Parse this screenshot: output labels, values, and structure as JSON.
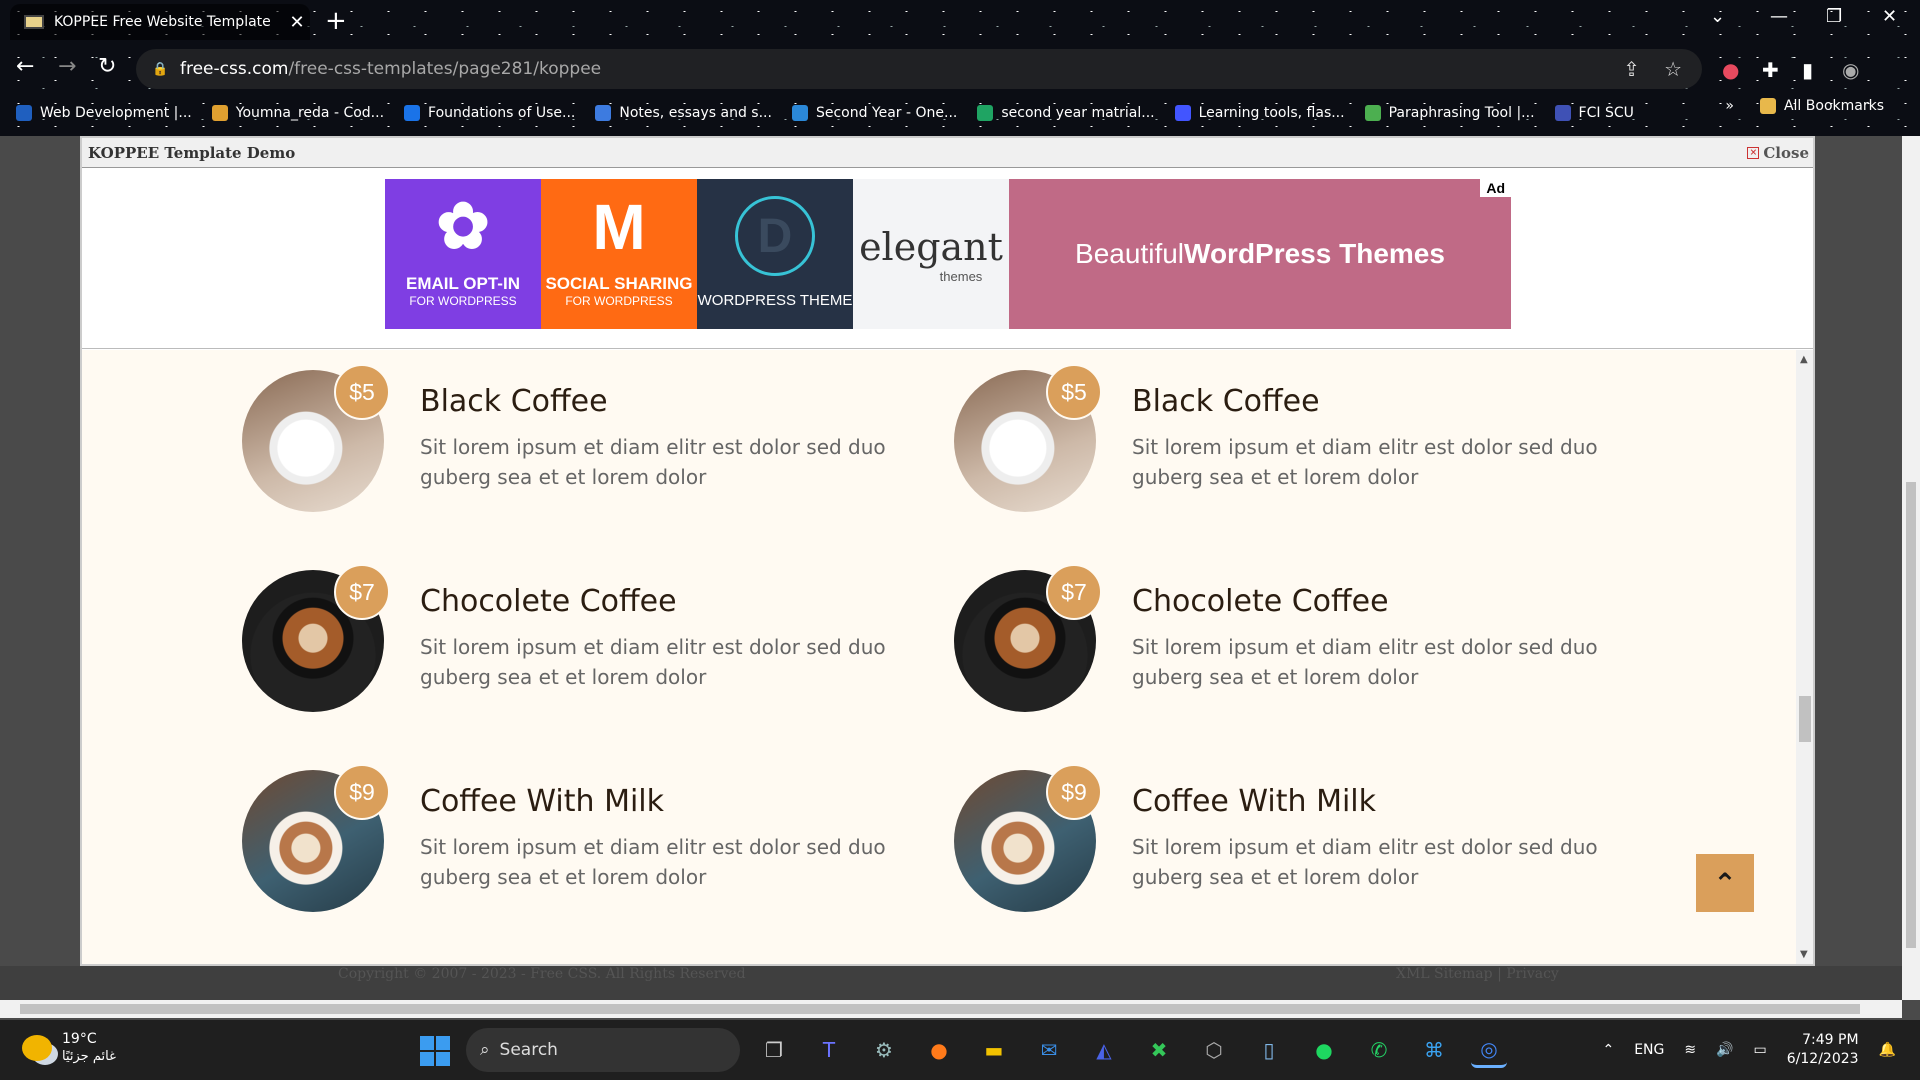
{
  "browser": {
    "tab_title": "KOPPEE Free Website Template |",
    "new_tab": "+",
    "url_host": "free-css.com",
    "url_path": "/free-css-templates/page281/koppee",
    "bookmarks": [
      {
        "label": "Web Development |...",
        "color": "#1f5fbf"
      },
      {
        "label": "Youmna_reda - Cod...",
        "color": "#e0a030"
      },
      {
        "label": "Foundations of Use...",
        "color": "#1a73e8"
      },
      {
        "label": "Notes, essays and s...",
        "color": "#3d7be0"
      },
      {
        "label": "Second Year - One...",
        "color": "#2b88d8"
      },
      {
        "label": "second year matrial...",
        "color": "#1fa463"
      },
      {
        "label": "Learning tools, flas...",
        "color": "#4255ff"
      },
      {
        "label": "Paraphrasing Tool |...",
        "color": "#4caf50"
      },
      {
        "label": "FCI SCU",
        "color": "#3f51b5"
      }
    ],
    "bookmarks_more": "»",
    "all_bookmarks": "All Bookmarks"
  },
  "frame": {
    "title": "KOPPEE Template Demo",
    "close_label": "Close"
  },
  "ad": {
    "badge": "Ad",
    "tile1_l1": "EMAIL OPT-IN",
    "tile1_l2": "FOR WORDPRESS",
    "tile2_l1": "SOCIAL SHARING",
    "tile2_l2": "FOR WORDPRESS",
    "tile3_letter": "D",
    "tile3_l1": "WORDPRESS THEME",
    "tile4_brand": "elegant",
    "tile4_sub": "themes",
    "headline_pre": "Beautiful ",
    "headline_bold": "WordPress Themes"
  },
  "menu": [
    {
      "name": "Black Coffee",
      "price": "$5",
      "desc": "Sit lorem ipsum et diam elitr est dolor sed duo guberg sea et et lorem dolor"
    },
    {
      "name": "Black Coffee",
      "price": "$5",
      "desc": "Sit lorem ipsum et diam elitr est dolor sed duo guberg sea et et lorem dolor"
    },
    {
      "name": "Chocolete Coffee",
      "price": "$7",
      "desc": "Sit lorem ipsum et diam elitr est dolor sed duo guberg sea et et lorem dolor"
    },
    {
      "name": "Chocolete Coffee",
      "price": "$7",
      "desc": "Sit lorem ipsum et diam elitr est dolor sed duo guberg sea et et lorem dolor"
    },
    {
      "name": "Coffee With Milk",
      "price": "$9",
      "desc": "Sit lorem ipsum et diam elitr est dolor sed duo guberg sea et et lorem dolor"
    },
    {
      "name": "Coffee With Milk",
      "price": "$9",
      "desc": "Sit lorem ipsum et diam elitr est dolor sed duo guberg sea et et lorem dolor"
    }
  ],
  "footer": {
    "copyright": "Copyright © 2007 - 2023 - Free CSS. All Rights Reserved",
    "links": "XML Sitemap | Privacy"
  },
  "taskbar": {
    "temp": "19°C",
    "condition": "غائم جزئيًا",
    "search": "Search",
    "lang": "ENG",
    "time": "7:49 PM",
    "date": "6/12/2023"
  },
  "colors": {
    "accent": "#da9f5b",
    "content_bg": "#fffaf2",
    "heading": "#2b1d11"
  }
}
